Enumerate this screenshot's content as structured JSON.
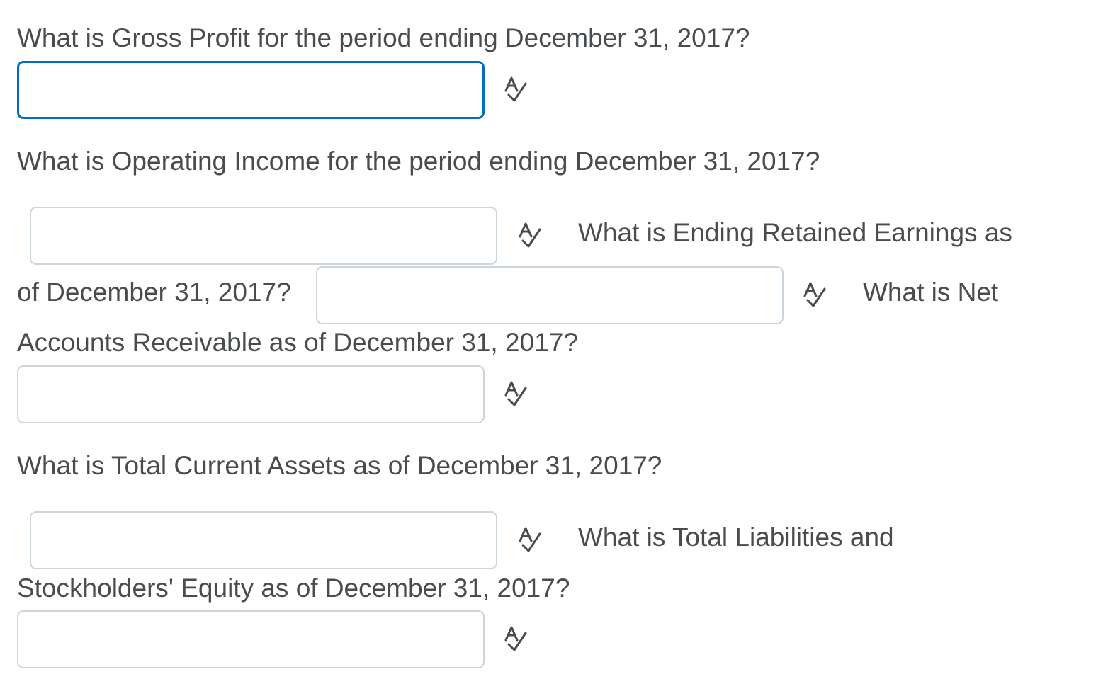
{
  "questions": [
    {
      "id": "gross_profit",
      "text": "What is Gross Profit for the period ending December 31, 2017?",
      "value": "",
      "focused": true
    },
    {
      "id": "operating_income",
      "text": "What is Operating Income for the period ending December 31, 2017?",
      "value": ""
    },
    {
      "id": "retained_earnings",
      "text_line1": "What is Ending Retained Earnings as",
      "text_line2": "of December 31, 2017?",
      "value": ""
    },
    {
      "id": "net_ar",
      "text_line1": "What is Net",
      "text_line2": "Accounts Receivable as of December 31, 2017?",
      "value": ""
    },
    {
      "id": "current_assets",
      "text": "What is Total Current Assets as of December 31, 2017?",
      "value": ""
    },
    {
      "id": "liabilities_equity",
      "text_line1": "What is Total Liabilities and",
      "text_line2": "Stockholders' Equity as of December 31, 2017?",
      "value": ""
    }
  ],
  "icons": {
    "spellcheck": "spellcheck-icon"
  },
  "colors": {
    "text": "#494c4e",
    "input_border": "#cdd5dc",
    "focus_border": "#006fbf"
  }
}
